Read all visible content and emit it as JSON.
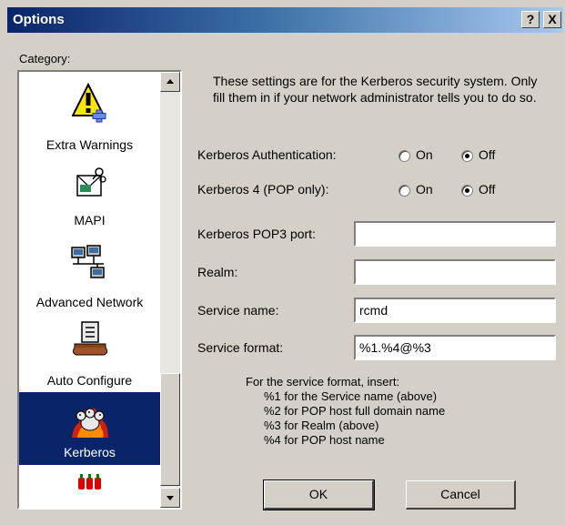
{
  "window": {
    "title": "Options",
    "help_glyph": "?",
    "close_glyph": "X"
  },
  "category": {
    "label": "Category:",
    "items": [
      {
        "label": "Extra Warnings",
        "icon": "warning-icon",
        "selected": false
      },
      {
        "label": "MAPI",
        "icon": "mail-envelope-icon",
        "selected": false
      },
      {
        "label": "Advanced Network",
        "icon": "network-computers-icon",
        "selected": false
      },
      {
        "label": "Auto Configure",
        "icon": "auto-configure-icon",
        "selected": false
      },
      {
        "label": "Kerberos",
        "icon": "kerberos-dog-icon",
        "selected": true
      },
      {
        "label": "",
        "icon": "hot-peppers-icon",
        "selected": false
      }
    ]
  },
  "intro_text": "These settings are for the Kerberos security system. Only fill them in if your network administrator tells you to do so.",
  "kerberos_auth": {
    "label": "Kerberos Authentication:",
    "on_label": "On",
    "off_label": "Off",
    "selected": "Off"
  },
  "kerberos4": {
    "label": "Kerberos 4 (POP only):",
    "on_label": "On",
    "off_label": "Off",
    "selected": "Off"
  },
  "fields": {
    "pop3_port": {
      "label": "Kerberos POP3 port:",
      "value": ""
    },
    "realm": {
      "label": "Realm:",
      "value": ""
    },
    "service_name": {
      "label": "Service name:",
      "value": "rcmd"
    },
    "service_format": {
      "label": "Service format:",
      "value": "%1.%4@%3"
    }
  },
  "hint": {
    "heading": "For the service format, insert:",
    "lines": [
      "%1 for the Service name (above)",
      "%2 for POP host full domain name",
      "%3 for Realm (above)",
      "%4 for POP host name"
    ]
  },
  "buttons": {
    "ok": "OK",
    "cancel": "Cancel"
  },
  "colors": {
    "title_bar": "#0a246a",
    "face": "#d4d0c8",
    "selection": "#0a246a"
  }
}
